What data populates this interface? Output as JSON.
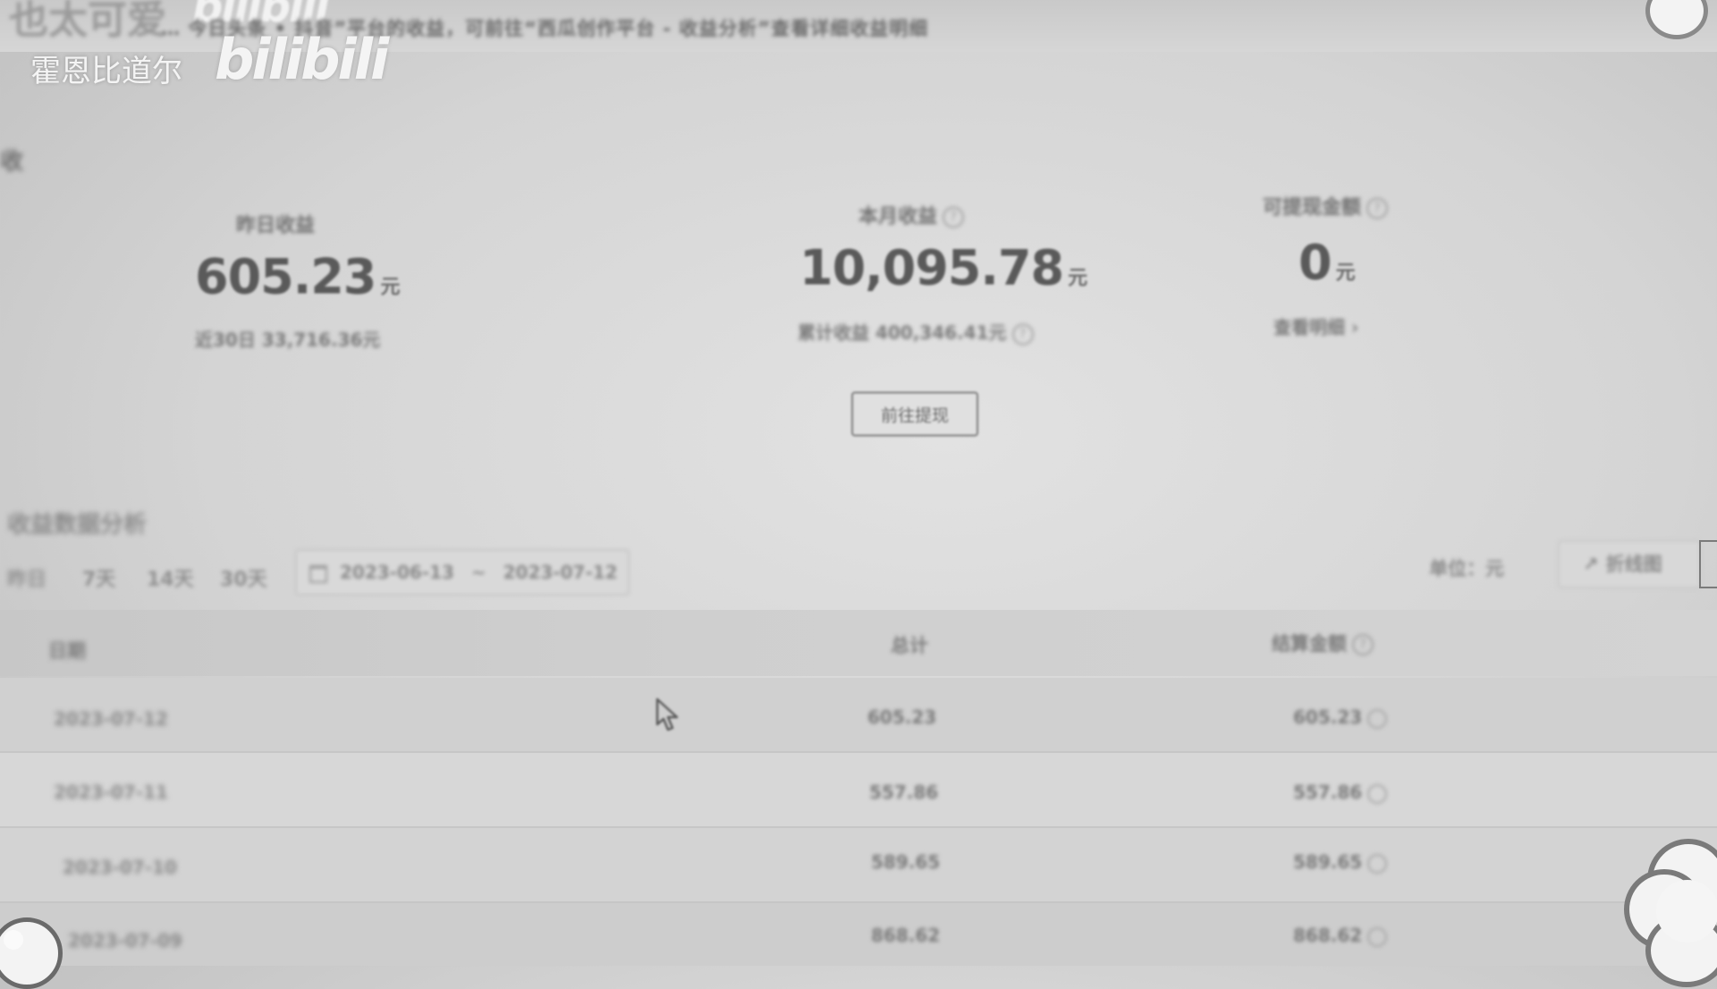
{
  "topbar": {
    "title": "也太可爱",
    "logo": "bilibili",
    "notice": "… 今日头条 • 抖音”平台的收益，可前往“西瓜创作平台 - 收益分析”查看详细收益明细"
  },
  "watermark": {
    "name": "霍恩比道尔",
    "logo": "bilibili"
  },
  "section_glyph": "收",
  "stats": {
    "yesterday": {
      "label": "昨日收益",
      "value": "605.23",
      "unit": "元",
      "sub": "近30日 33,716.36元"
    },
    "month": {
      "label": "本月收益",
      "value": "10,095.78",
      "unit": "元",
      "sub": "累计收益 400,346.41元"
    },
    "withdrawable": {
      "label": "可提现金额",
      "value": "0",
      "unit": "元",
      "link": "查看明细 ›"
    },
    "help_glyph": "?"
  },
  "withdraw_button": "前往提现",
  "analysis": {
    "title": "收益数据分析",
    "tabs": [
      "昨日",
      "7天",
      "14天",
      "30天"
    ],
    "date_start": "2023-06-13",
    "date_sep": "~",
    "date_end": "2023-07-12",
    "unit_label": "单位：元",
    "chart_button": "折线图"
  },
  "table": {
    "headers": {
      "date": "日期",
      "total": "总计",
      "amount": "结算金额"
    },
    "rows": [
      {
        "date": "2023-07-12",
        "total": "605.23",
        "amount": "605.23"
      },
      {
        "date": "2023-07-11",
        "total": "557.86",
        "amount": "557.86"
      },
      {
        "date": "2023-07-10",
        "total": "589.65",
        "amount": "589.65"
      },
      {
        "date": "2023-07-09",
        "total": "868.62",
        "amount": "868.62"
      }
    ]
  }
}
